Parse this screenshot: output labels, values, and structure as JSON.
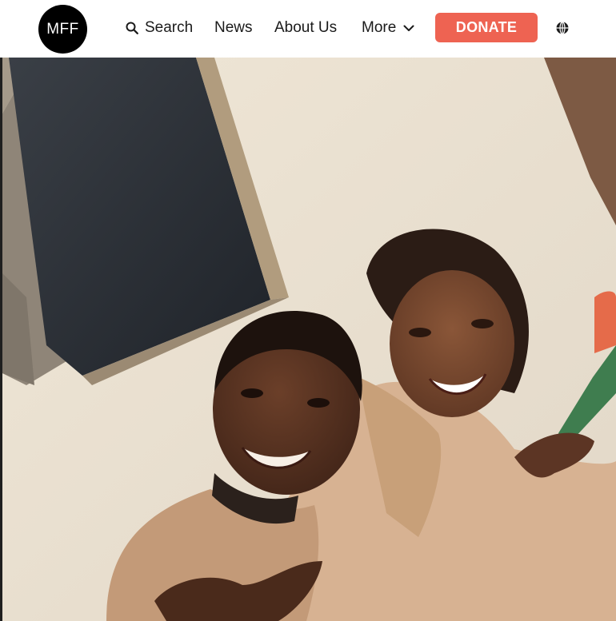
{
  "header": {
    "logo_text": "MFF",
    "nav": {
      "search_label": "Search",
      "news_label": "News",
      "about_label": "About Us",
      "more_label": "More"
    },
    "donate_label": "DONATE",
    "icons": {
      "search": "search-icon",
      "more": "chevron-down-icon",
      "language": "globe-icon"
    }
  },
  "colors": {
    "donate_button": "#ee6352",
    "logo_background": "#000000",
    "text": "#1a1a1a"
  }
}
